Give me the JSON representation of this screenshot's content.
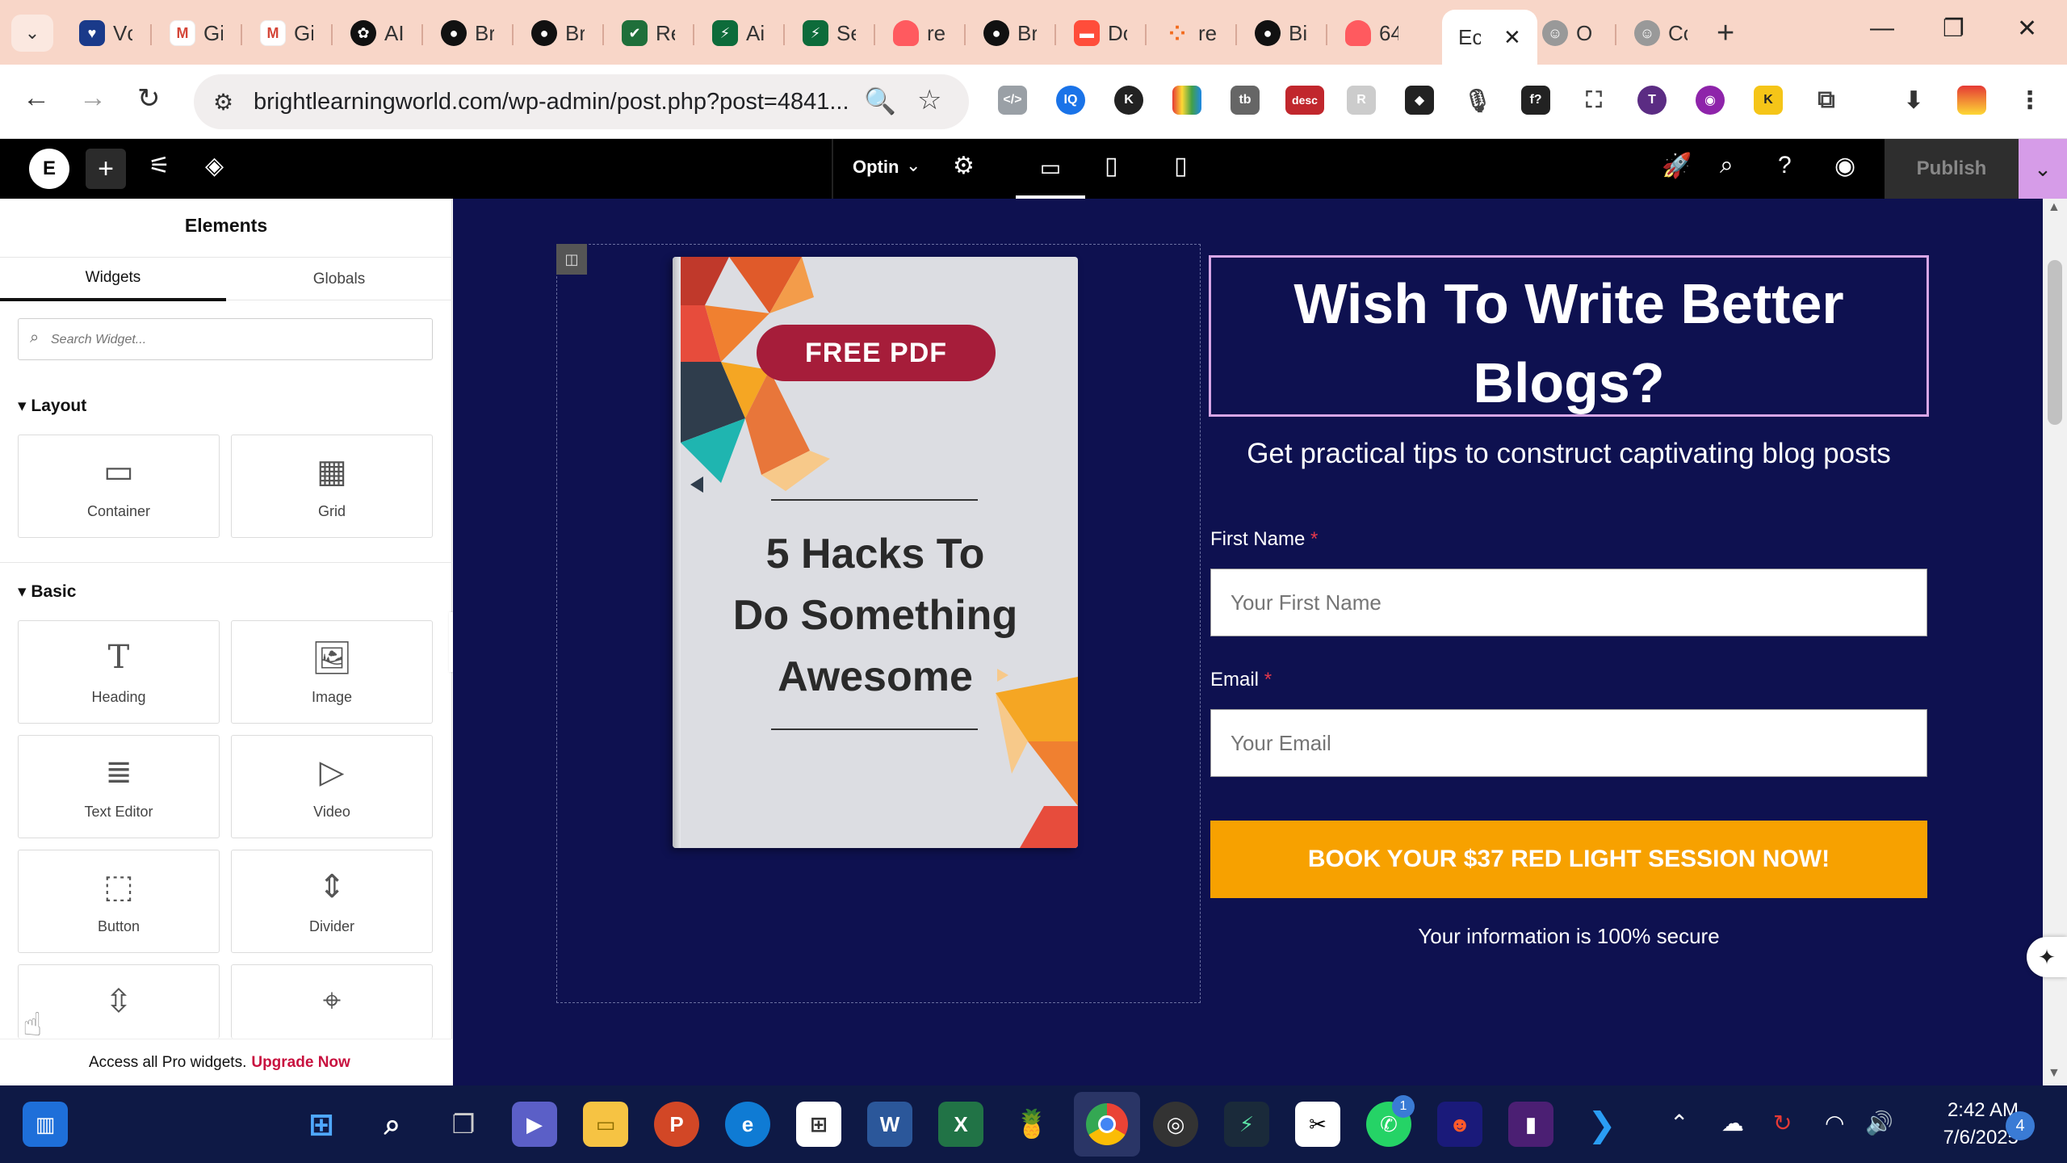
{
  "browser": {
    "tabs": [
      {
        "label": "Vc",
        "icon": "shield-heart-icon",
        "color": "#1a3a8a"
      },
      {
        "label": "Gi",
        "icon": "gmail-icon",
        "color": "#d44638"
      },
      {
        "label": "Gi",
        "icon": "gmail-icon",
        "color": "#d44638"
      },
      {
        "label": "AI",
        "icon": "openai-icon",
        "color": "#111111"
      },
      {
        "label": "Br",
        "icon": "github-icon",
        "color": "#111111"
      },
      {
        "label": "Br",
        "icon": "github-icon",
        "color": "#111111"
      },
      {
        "label": "Re",
        "icon": "check-badge-icon",
        "color": "#1f6f3a"
      },
      {
        "label": "Ai",
        "icon": "bolt-icon",
        "color": "#0d6b3a"
      },
      {
        "label": "Se",
        "icon": "bolt-icon",
        "color": "#0d6b3a"
      },
      {
        "label": "re",
        "icon": "flame-icon",
        "color": "#ff5a5f"
      },
      {
        "label": "Br",
        "icon": "github-icon",
        "color": "#111111"
      },
      {
        "label": "Dc",
        "icon": "doc-icon",
        "color": "#ff4d3a"
      },
      {
        "label": "re",
        "icon": "dots-icon",
        "color": "#f26b1d"
      },
      {
        "label": "Bi",
        "icon": "github-icon",
        "color": "#111111"
      },
      {
        "label": "64",
        "icon": "flame-icon",
        "color": "#ff5a5f"
      }
    ],
    "active_tab": {
      "label": "Ec",
      "close": "✕"
    },
    "after_tabs": [
      {
        "label": "O",
        "icon": "avatar-icon",
        "color": "#888888"
      },
      {
        "label": "Cc",
        "icon": "avatar-icon",
        "color": "#888888"
      }
    ],
    "url": "brightlearningworld.com/wp-admin/post.php?post=4841..."
  },
  "elementor": {
    "page_name": "Optin",
    "publish_label": "Publish",
    "panel": {
      "title": "Elements",
      "tabs": [
        "Widgets",
        "Globals"
      ],
      "search_placeholder": "Search Widget...",
      "layout_section": "Layout",
      "basic_section": "Basic",
      "layout_widgets": [
        {
          "label": "Container",
          "icon": "▭"
        },
        {
          "label": "Grid",
          "icon": "▦"
        }
      ],
      "basic_widgets": [
        {
          "label": "Heading",
          "icon": "T"
        },
        {
          "label": "Image",
          "icon": "🖼"
        },
        {
          "label": "Text Editor",
          "icon": "≣"
        },
        {
          "label": "Video",
          "icon": "▷"
        },
        {
          "label": "Button",
          "icon": "⬚"
        },
        {
          "label": "Divider",
          "icon": "⇕"
        }
      ],
      "pro_text": "Access all Pro widgets.",
      "pro_link": "Upgrade Now"
    }
  },
  "canvas": {
    "book": {
      "badge": "FREE PDF",
      "title_lines": [
        "5 Hacks To",
        "Do Something",
        "Awesome"
      ]
    },
    "headline_lines": [
      "Wish To Write Better",
      "Blogs?"
    ],
    "subhead": "Get practical tips to construct captivating blog posts",
    "first_name_label": "First Name",
    "first_name_placeholder": "Your First Name",
    "email_label": "Email",
    "email_placeholder": "Your Email",
    "required_mark": "*",
    "cta": "BOOK YOUR $37 RED LIGHT SESSION NOW!",
    "secure_note": "Your information is 100% secure"
  },
  "taskbar": {
    "time": "2:42 AM",
    "date": "7/6/2025",
    "notifications": "4",
    "whatsapp_badge": "1"
  },
  "colors": {
    "canvas_bg": "#0e1150",
    "cta": "#f7a100",
    "badge": "#a61d3a",
    "headline_border": "#d7a6e6",
    "publish_caret": "#d69ce8"
  }
}
